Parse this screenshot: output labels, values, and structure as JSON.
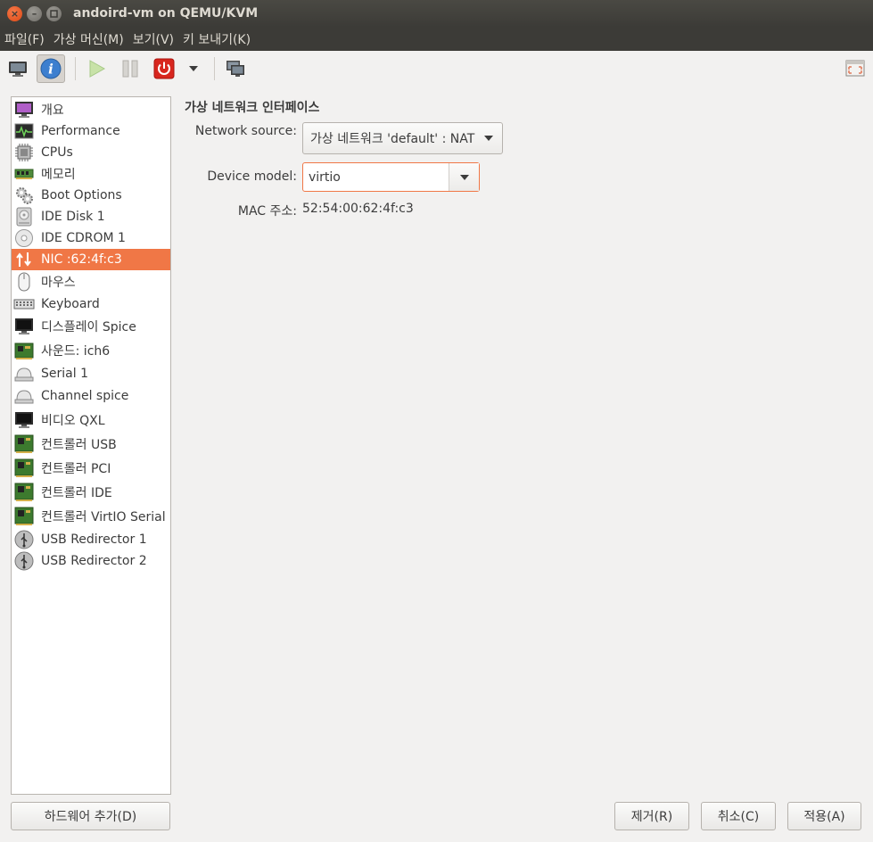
{
  "window": {
    "title": "andoird-vm on QEMU/KVM"
  },
  "menu": [
    "파일(F)",
    "가상 머신(M)",
    "보기(V)",
    "키 보내기(K)"
  ],
  "toolbar": {
    "buttons": [
      "console-icon",
      "details-icon",
      "run-icon",
      "pause-icon",
      "shutdown-icon",
      "shutdown-menu-icon",
      "snapshots-icon",
      "fullscreen-icon"
    ],
    "active": "details-icon"
  },
  "hardware": [
    {
      "label": "개요",
      "icon": "overview-icon"
    },
    {
      "label": "Performance",
      "icon": "performance-icon"
    },
    {
      "label": "CPUs",
      "icon": "cpu-icon"
    },
    {
      "label": "메모리",
      "icon": "memory-icon"
    },
    {
      "label": "Boot Options",
      "icon": "boot-options-icon"
    },
    {
      "label": "IDE Disk 1",
      "icon": "disk-icon"
    },
    {
      "label": "IDE CDROM 1",
      "icon": "cdrom-icon"
    },
    {
      "label": "NIC :62:4f:c3",
      "icon": "nic-icon"
    },
    {
      "label": "마우스",
      "icon": "mouse-icon"
    },
    {
      "label": "Keyboard",
      "icon": "keyboard-icon"
    },
    {
      "label": "디스플레이 Spice",
      "icon": "display-icon"
    },
    {
      "label": "사운드: ich6",
      "icon": "sound-icon"
    },
    {
      "label": "Serial 1",
      "icon": "serial-icon"
    },
    {
      "label": "Channel spice",
      "icon": "channel-icon"
    },
    {
      "label": "비디오 QXL",
      "icon": "video-icon"
    },
    {
      "label": "컨트롤러 USB",
      "icon": "controller-icon"
    },
    {
      "label": "컨트롤러 PCI",
      "icon": "controller-icon"
    },
    {
      "label": "컨트롤러 IDE",
      "icon": "controller-icon"
    },
    {
      "label": "컨트롤러 VirtIO Serial",
      "icon": "controller-icon"
    },
    {
      "label": "USB Redirector 1",
      "icon": "usb-redirector-icon"
    },
    {
      "label": "USB Redirector 2",
      "icon": "usb-redirector-icon"
    }
  ],
  "selected_index": 7,
  "detail": {
    "section_title": "가상 네트워크 인터페이스",
    "network_source_label": "Network source:",
    "network_source_value": "가상 네트워크 'default' : NAT",
    "device_model_label": "Device model:",
    "device_model_value": "virtio",
    "mac_label": "MAC 주소:",
    "mac_value": "52:54:00:62:4f:c3"
  },
  "buttons": {
    "add_hardware": "하드웨어 추가(D)",
    "remove": "제거(R)",
    "cancel": "취소(C)",
    "apply": "적용(A)"
  },
  "colors": {
    "accent": "#f07746",
    "titlebar": "#3c3b37",
    "window_bg": "#f2f1f0"
  }
}
